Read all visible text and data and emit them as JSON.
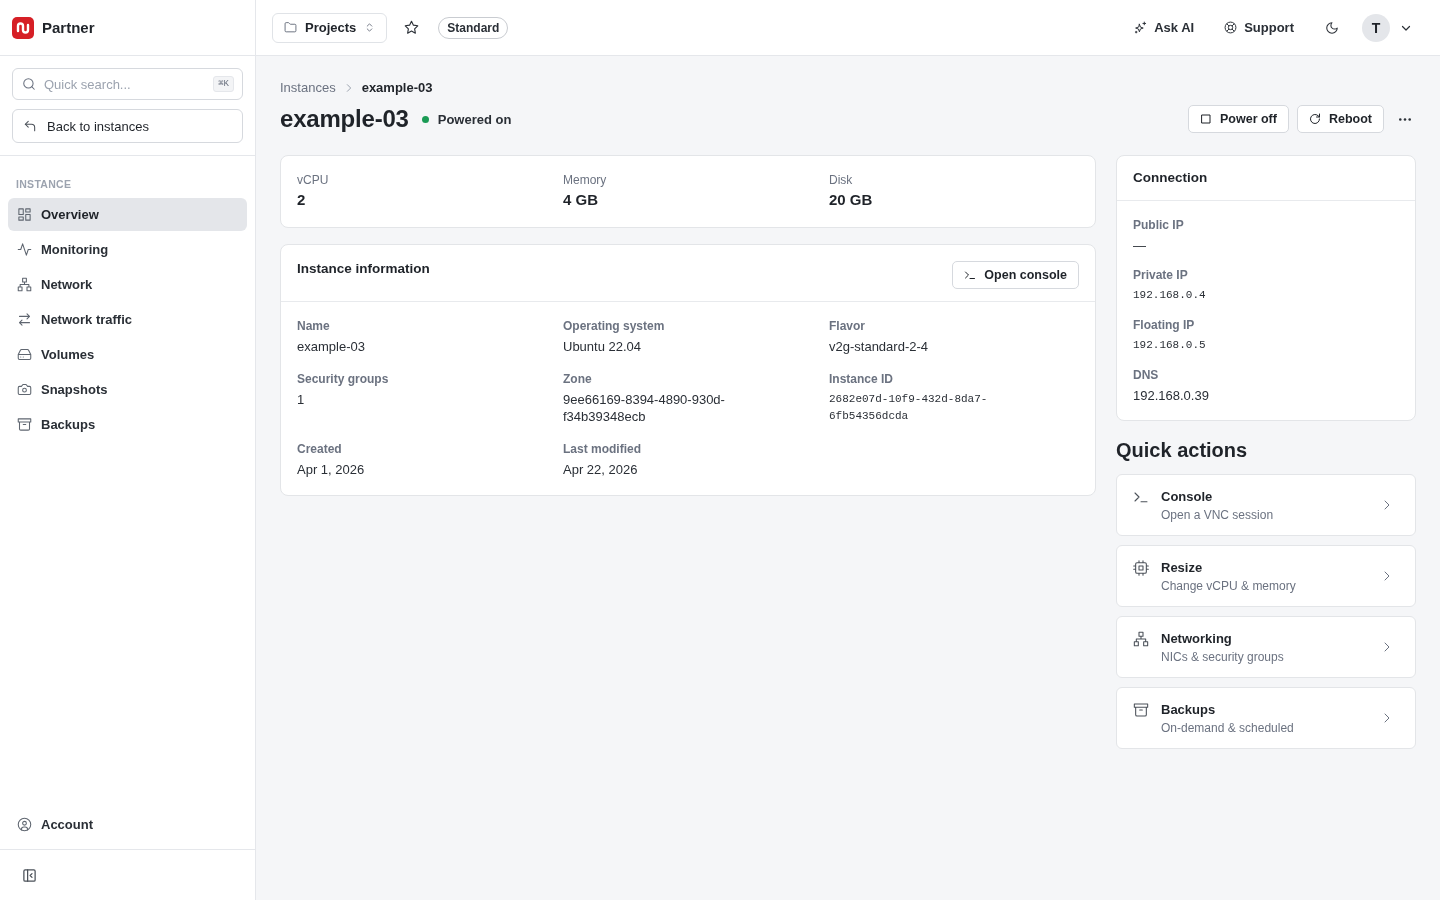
{
  "sidebar": {
    "brand": "Partner",
    "search": {
      "placeholder": "Quick search...",
      "shortcut": "⌘K"
    },
    "back_button": "Back to instances",
    "section_label": "INSTANCE",
    "items": [
      {
        "label": "Overview",
        "selected": true
      },
      {
        "label": "Monitoring",
        "selected": false
      },
      {
        "label": "Network",
        "selected": false
      },
      {
        "label": "Network traffic",
        "selected": false
      },
      {
        "label": "Volumes",
        "selected": false
      },
      {
        "label": "Snapshots",
        "selected": false
      },
      {
        "label": "Backups",
        "selected": false
      }
    ],
    "account": "Account"
  },
  "topbar": {
    "project_switcher": "Projects",
    "starred": false,
    "plan_badge": "Standard",
    "ask_ai": "Ask AI",
    "support": "Support",
    "avatar_initial": "T"
  },
  "page": {
    "breadcrumb": [
      {
        "label": "Instances"
      },
      {
        "label": "example-03"
      }
    ],
    "title": "example-03",
    "status": {
      "label": "Powered on",
      "color": "#1a9b55"
    },
    "actions": [
      {
        "label": "Power off"
      },
      {
        "label": "Reboot"
      }
    ]
  },
  "specs": [
    {
      "label": "vCPU",
      "value": "2"
    },
    {
      "label": "Memory",
      "value": "4 GB"
    },
    {
      "label": "Disk",
      "value": "20 GB"
    }
  ],
  "instance_info": {
    "title": "Instance information",
    "button": "Open console",
    "fields": [
      {
        "label": "Name",
        "value": "example-03",
        "kind": "text"
      },
      {
        "label": "Operating system",
        "value": "Ubuntu 22.04",
        "kind": "text"
      },
      {
        "label": "Flavor",
        "value": "v2g-standard-2-4",
        "kind": "text"
      },
      {
        "label": "Security groups",
        "value": "1",
        "kind": "text"
      },
      {
        "label": "Zone",
        "value": "9ee66169-8394-4890-930d-f34b39348ecb",
        "kind": "text"
      },
      {
        "label": "Instance ID",
        "value": "2682e07d-10f9-432d-8da7-6fb54356dcda",
        "kind": "mono"
      },
      {
        "label": "Created",
        "value": "Apr 1, 2026",
        "kind": "text"
      },
      {
        "label": "Last modified",
        "value": "Apr 22, 2026",
        "kind": "text"
      }
    ]
  },
  "connection": {
    "title": "Connection",
    "fields": [
      {
        "label": "Public IP",
        "value": "—",
        "kind": "text"
      },
      {
        "label": "Private IP",
        "value": "192.168.0.4",
        "kind": "mono"
      },
      {
        "label": "Floating IP",
        "value": "192.168.0.5",
        "kind": "mono"
      },
      {
        "label": "DNS",
        "value": "192.168.0.39",
        "kind": "text"
      }
    ]
  },
  "quick_actions": {
    "title": "Quick actions",
    "items": [
      {
        "title": "Console",
        "subtitle": "Open a VNC session"
      },
      {
        "title": "Resize",
        "subtitle": "Change vCPU & memory"
      },
      {
        "title": "Networking",
        "subtitle": "NICs & security groups"
      },
      {
        "title": "Backups",
        "subtitle": "On-demand & scheduled"
      }
    ]
  }
}
